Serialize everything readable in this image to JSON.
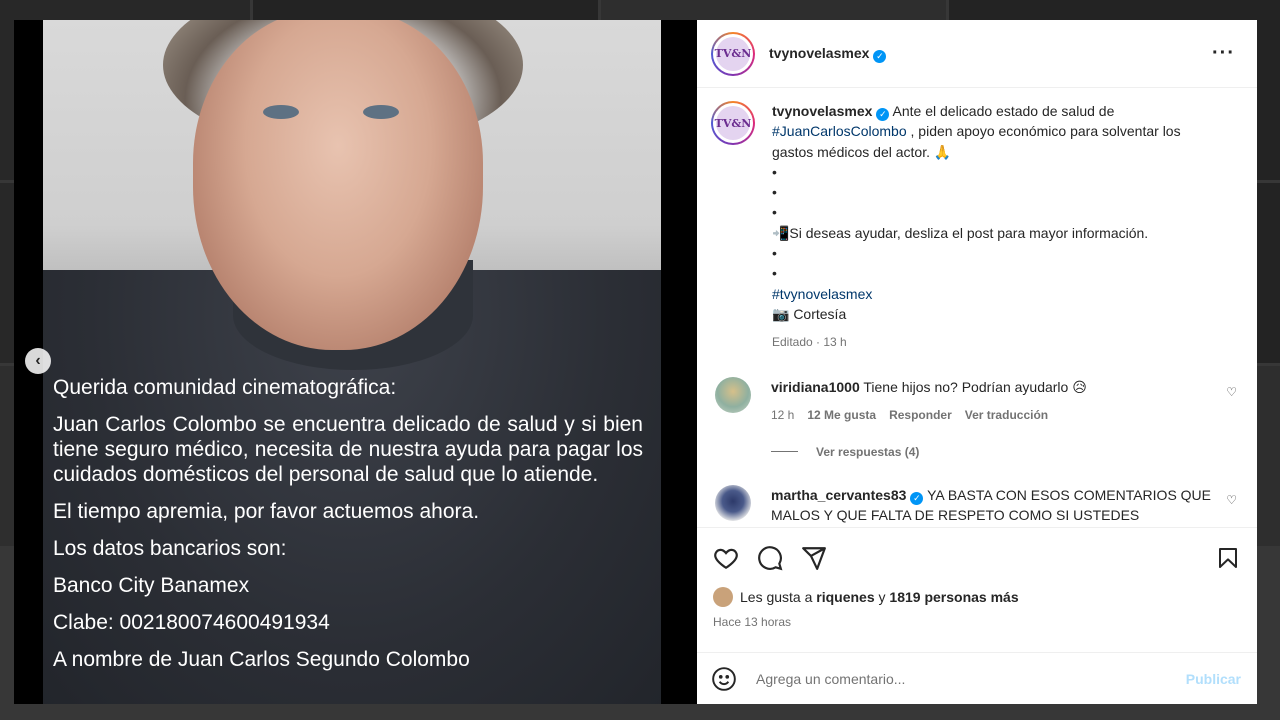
{
  "post": {
    "username": "tvynovelasmex",
    "avatar_initials": "TV&N",
    "photo_text": {
      "greeting": "Querida comunidad cinematográfica:",
      "paragraph1": "Juan Carlos Colombo se encuentra delicado de salud y si bien tiene seguro médico, necesita de nuestra ayuda para pagar los cuidados domésticos del personal de salud que lo atiende.",
      "paragraph2": "El tiempo apremia, por favor actuemos ahora.",
      "paragraph3": "Los datos bancarios son:",
      "bank": "Banco City Banamex",
      "clabe": "Clabe: 002180074600491934",
      "holder": "A nombre de Juan Carlos Segundo Colombo"
    },
    "caption": {
      "line1": "Ante el delicado estado de salud de",
      "hashtag1": "#JuanCarlosColombo",
      "line2": ", piden apoyo económico para solventar los gastos médicos del actor. 🙏",
      "dot": "•",
      "cta": "📲Si deseas ayudar, desliza el post para mayor información.",
      "hashtag2": "#tvynovelasmex",
      "credit": "📷 Cortesía",
      "meta": "Editado · 13 h"
    },
    "comments": [
      {
        "username": "viridiana1000",
        "text": "Tiene hijos no? Podrían ayudarlo 😥",
        "time": "12 h",
        "likes": "12 Me gusta",
        "reply": "Responder",
        "translate": "Ver traducción",
        "view_replies": "Ver respuestas (4)"
      },
      {
        "username": "martha_cervantes83",
        "text": "YA BASTA CON ESOS COMENTARIOS QUE MALOS Y QUE FALTA DE RESPETO COMO SI USTEDES"
      }
    ],
    "likes": {
      "prefix": "Les gusta a",
      "user": "riquenes",
      "joiner": "y",
      "others": "1819 personas más"
    },
    "posted": "Hace 13 horas",
    "comment_placeholder": "Agrega un comentario...",
    "publish_label": "Publicar"
  },
  "colors": {
    "verified": "#0095f6",
    "hashtag": "#00376b",
    "publish_disabled": "#b2dffc",
    "muted": "#737373"
  }
}
